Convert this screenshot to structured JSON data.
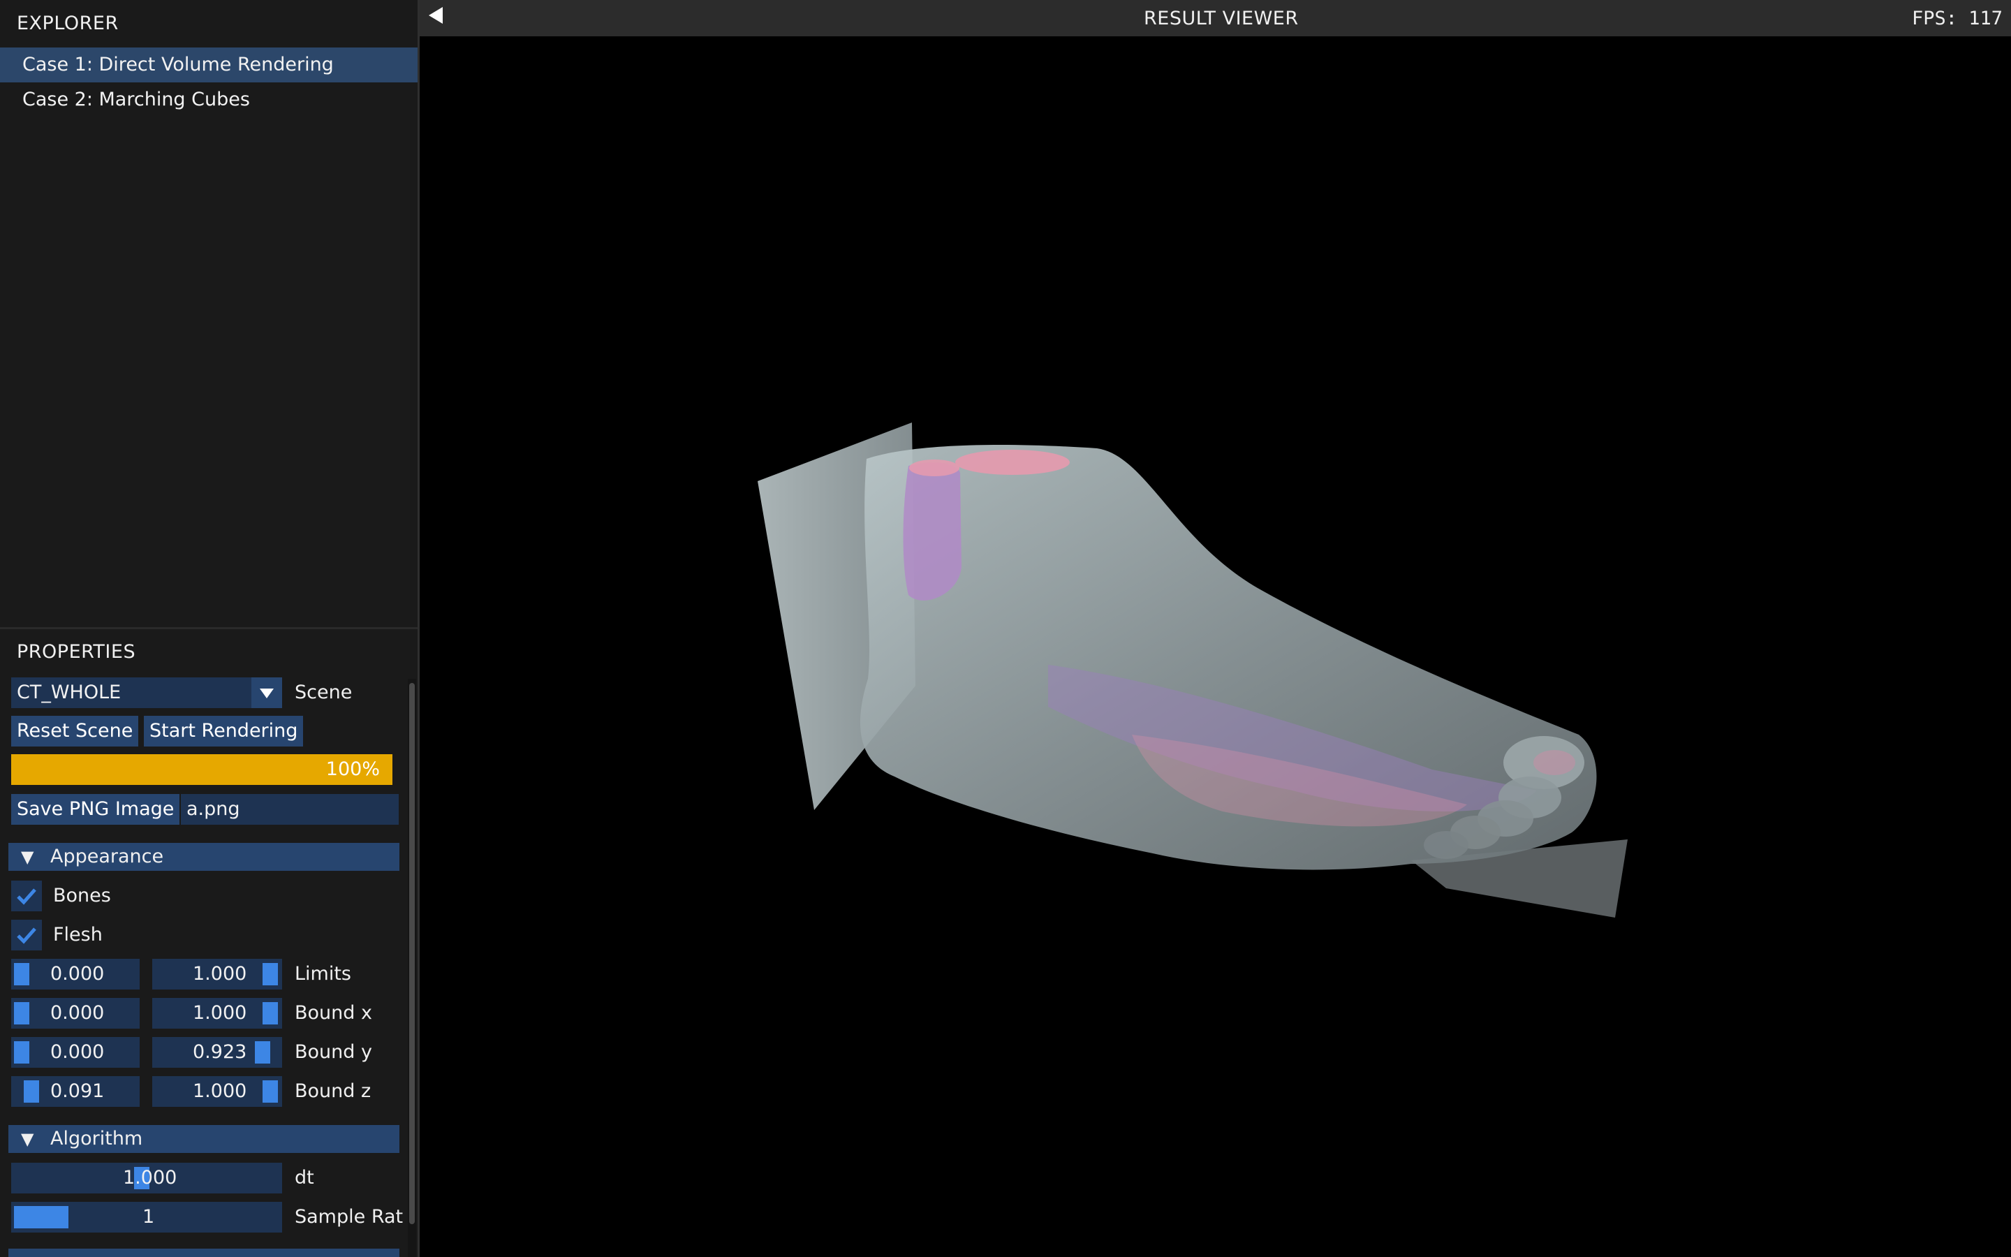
{
  "explorer": {
    "title": "EXPLORER",
    "items": [
      {
        "label": "Case 1: Direct Volume Rendering",
        "selected": true
      },
      {
        "label": "Case 2: Marching Cubes",
        "selected": false
      }
    ]
  },
  "properties": {
    "title": "PROPERTIES",
    "scene": {
      "value": "CT_WHOLE",
      "label": "Scene"
    },
    "buttons": {
      "reset": "Reset Scene",
      "start": "Start Rendering"
    },
    "progress": {
      "text": "100%",
      "fraction": 1.0
    },
    "save": {
      "button": "Save PNG Image",
      "filename": "a.png"
    },
    "appearance": {
      "header": "Appearance",
      "bones": {
        "label": "Bones",
        "checked": true
      },
      "flesh": {
        "label": "Flesh",
        "checked": true
      },
      "rows": [
        {
          "min": "0.000",
          "max": "1.000",
          "label": "Limits"
        },
        {
          "min": "0.000",
          "max": "1.000",
          "label": "Bound x"
        },
        {
          "min": "0.000",
          "max": "0.923",
          "label": "Bound y"
        },
        {
          "min": "0.091",
          "max": "1.000",
          "label": "Bound z"
        }
      ]
    },
    "algorithm": {
      "header": "Algorithm",
      "dt": {
        "value": "1.000",
        "label": "dt"
      },
      "sample_rate": {
        "value": "1",
        "label": "Sample Rat"
      }
    }
  },
  "viewer": {
    "title": "RESULT VIEWER",
    "fps": "FPS: 117"
  },
  "colors": {
    "accent": "#3d86e5",
    "progress": "#e6a800",
    "panel": "#1a1a1a",
    "widget": "#1e3352",
    "button": "#27456f",
    "selected": "#2c476a"
  }
}
